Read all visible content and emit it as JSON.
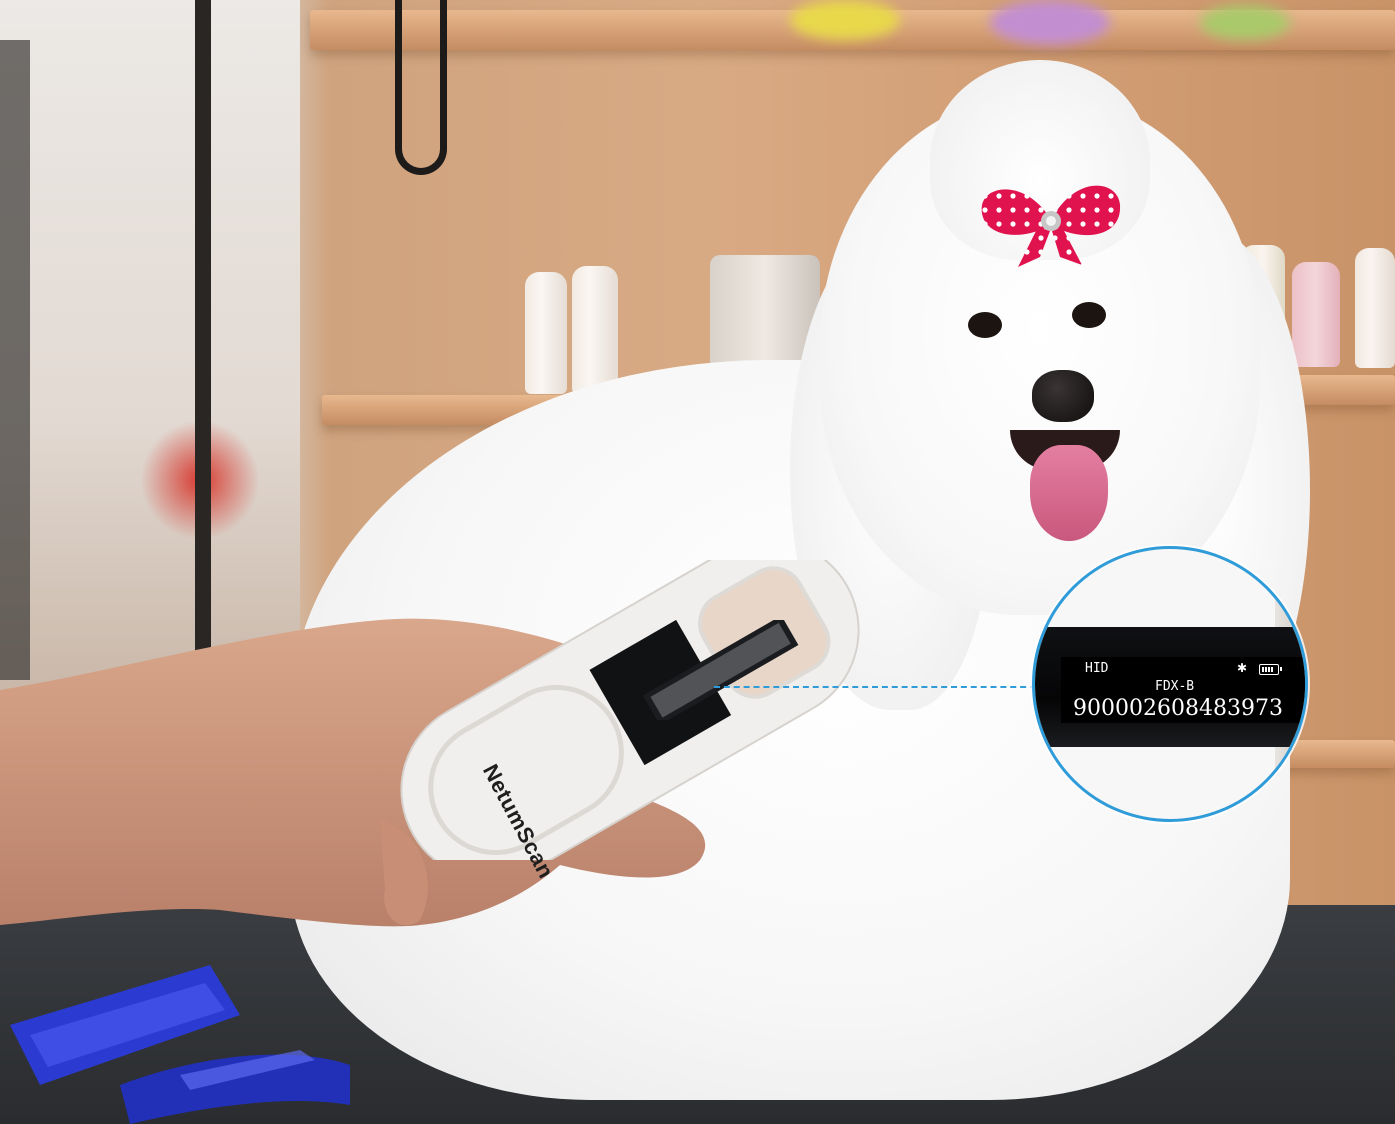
{
  "scene": {
    "brand": "NetumScan",
    "device_screen": {
      "mode": "HID",
      "tag_type": "FDX-B",
      "chip_number": "900002608483973"
    },
    "icons": [
      "bluetooth-icon",
      "battery-icon"
    ],
    "colors": {
      "callout_border": "#2f9bd8",
      "bow_red": "#e0134f",
      "brush_blue": "#2b3bd1"
    }
  }
}
